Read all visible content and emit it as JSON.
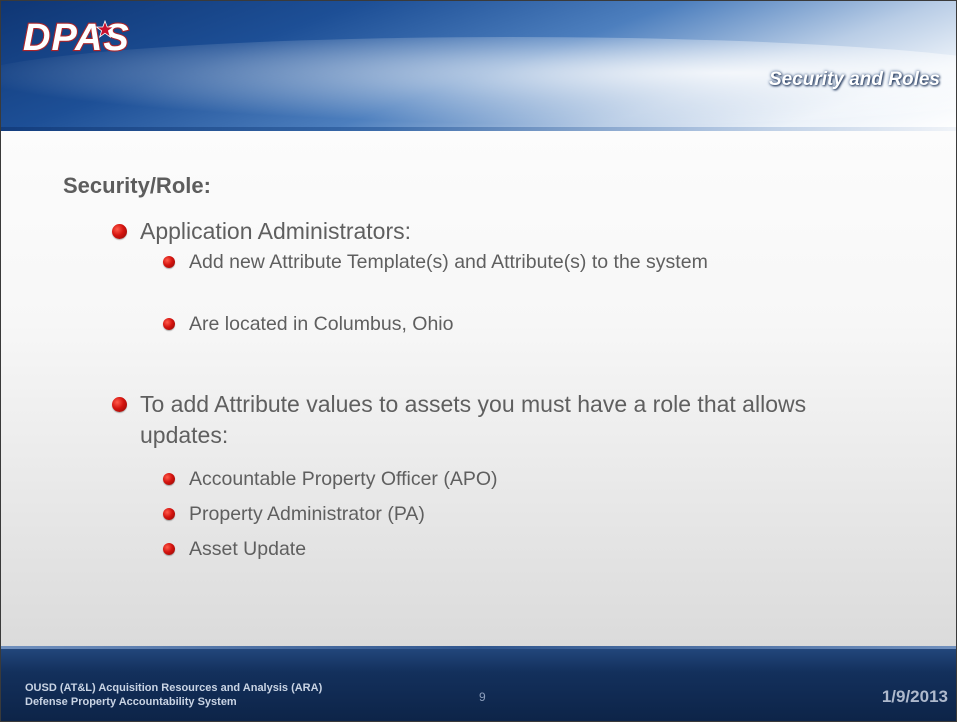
{
  "header": {
    "logo_text": "DPAS",
    "section_title": "Security and Roles"
  },
  "content": {
    "heading": "Security/Role:",
    "groups": [
      {
        "text": "Application Administrators:",
        "subitems": [
          "Add new Attribute Template(s) and Attribute(s) to the system",
          "Are located in Columbus, Ohio"
        ]
      },
      {
        "text": "To add Attribute values to assets you must have a role that allows updates:",
        "subitems": [
          "Accountable Property Officer (APO)",
          "Property Administrator (PA)",
          "Asset Update"
        ]
      }
    ]
  },
  "footer": {
    "org_line1": "OUSD (AT&L) Acquisition Resources and Analysis (ARA)",
    "org_line2": "Defense Property Accountability System",
    "page_number": "9",
    "date": "1/9/2013"
  },
  "colors": {
    "header_blue": "#1d4f96",
    "footer_blue": "#13305c",
    "bullet_red": "#d4140f",
    "text_gray": "#5f5f5f"
  }
}
